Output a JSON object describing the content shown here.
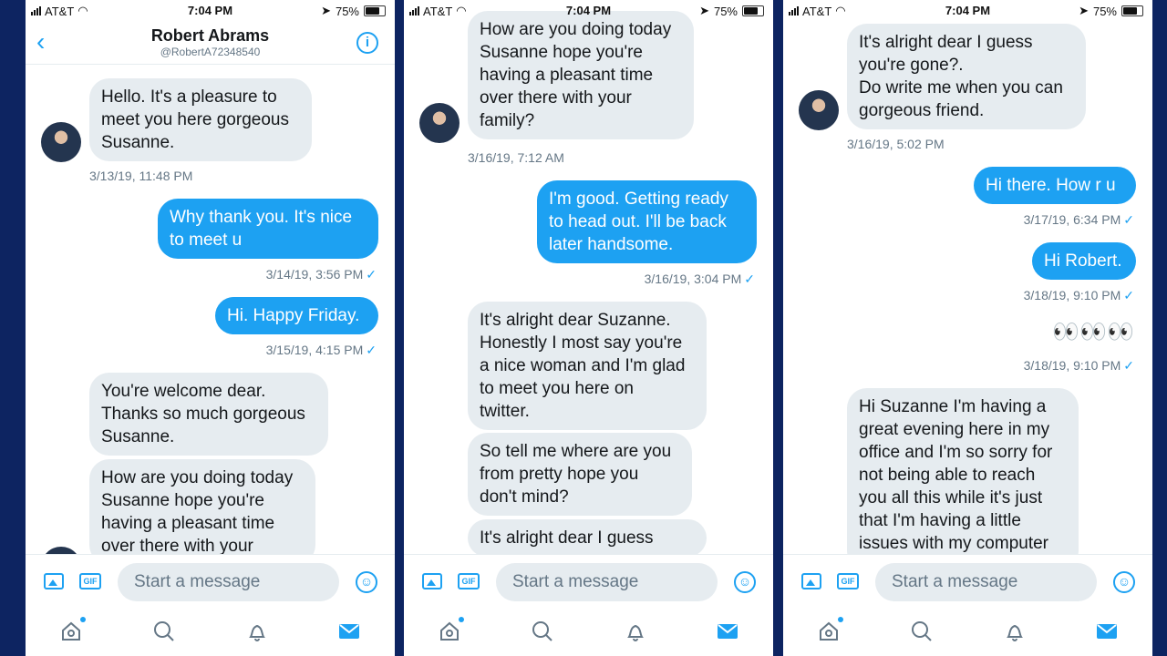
{
  "status": {
    "carrier": "AT&T",
    "time": "7:04 PM",
    "battery": "75%"
  },
  "conversation": {
    "name": "Robert Abrams",
    "handle": "@RobertA72348540"
  },
  "composer": {
    "placeholder": "Start a message",
    "gif_label": "GIF"
  },
  "panel1": {
    "msg1": "Hello. It's a pleasure to\nmeet you here gorgeous\nSusanne.",
    "ts1": "3/13/19, 11:48 PM",
    "msg2": "Why thank you.  It's nice\nto meet u",
    "ts2": "3/14/19, 3:56 PM",
    "msg3": "Hi.  Happy Friday.",
    "ts3": "3/15/19, 4:15 PM",
    "msg4": "You're welcome dear.\nThanks so much gorgeous\nSusanne.",
    "msg5": "How are you doing today\nSusanne hope you're\nhaving a pleasant time\nover there with your"
  },
  "panel2": {
    "msg1": "How are you doing today\nSusanne hope you're\nhaving a pleasant time\nover there with your\nfamily?",
    "ts1": "3/16/19, 7:12 AM",
    "msg2": "I'm good.  Getting ready\nto head out.  I'll be back\nlater handsome.",
    "ts2": "3/16/19, 3:04 PM",
    "msg3": "It's alright dear Suzanne.\nHonestly I most say you're\na nice woman and I'm glad\nto meet you here on\ntwitter.",
    "msg4": "So tell me where are you\nfrom pretty hope you\ndon't mind?",
    "msg5": "It's alright dear I guess"
  },
  "panel3": {
    "msg1": "It's alright dear I guess\nyou're gone?.\nDo write me when you can\ngorgeous friend.",
    "ts1": "3/16/19, 5:02 PM",
    "msg2": "Hi there.  How r u",
    "ts2": "3/17/19, 6:34 PM",
    "msg3": "Hi Robert.",
    "ts3": "3/18/19, 9:10 PM",
    "msg4": "👀👀👀",
    "ts4": "3/18/19, 9:10 PM",
    "msg5": "Hi Suzanne I'm having a\ngreat evening here in my\noffice and I'm so sorry for\nnot being able to reach\nyou all this while it's just\nthat I'm having a little\nissues with my computer"
  },
  "icons": {
    "back": "chevron-left-icon",
    "info": "info-icon",
    "media": "image-icon",
    "gif": "gif-icon",
    "emoji": "smile-icon",
    "home": "home-icon",
    "search": "search-icon",
    "notifications": "bell-icon",
    "messages": "mail-icon"
  },
  "colors": {
    "accent": "#1da1f2",
    "incoming_bubble": "#e6ecf0",
    "background": "#0d2461"
  }
}
